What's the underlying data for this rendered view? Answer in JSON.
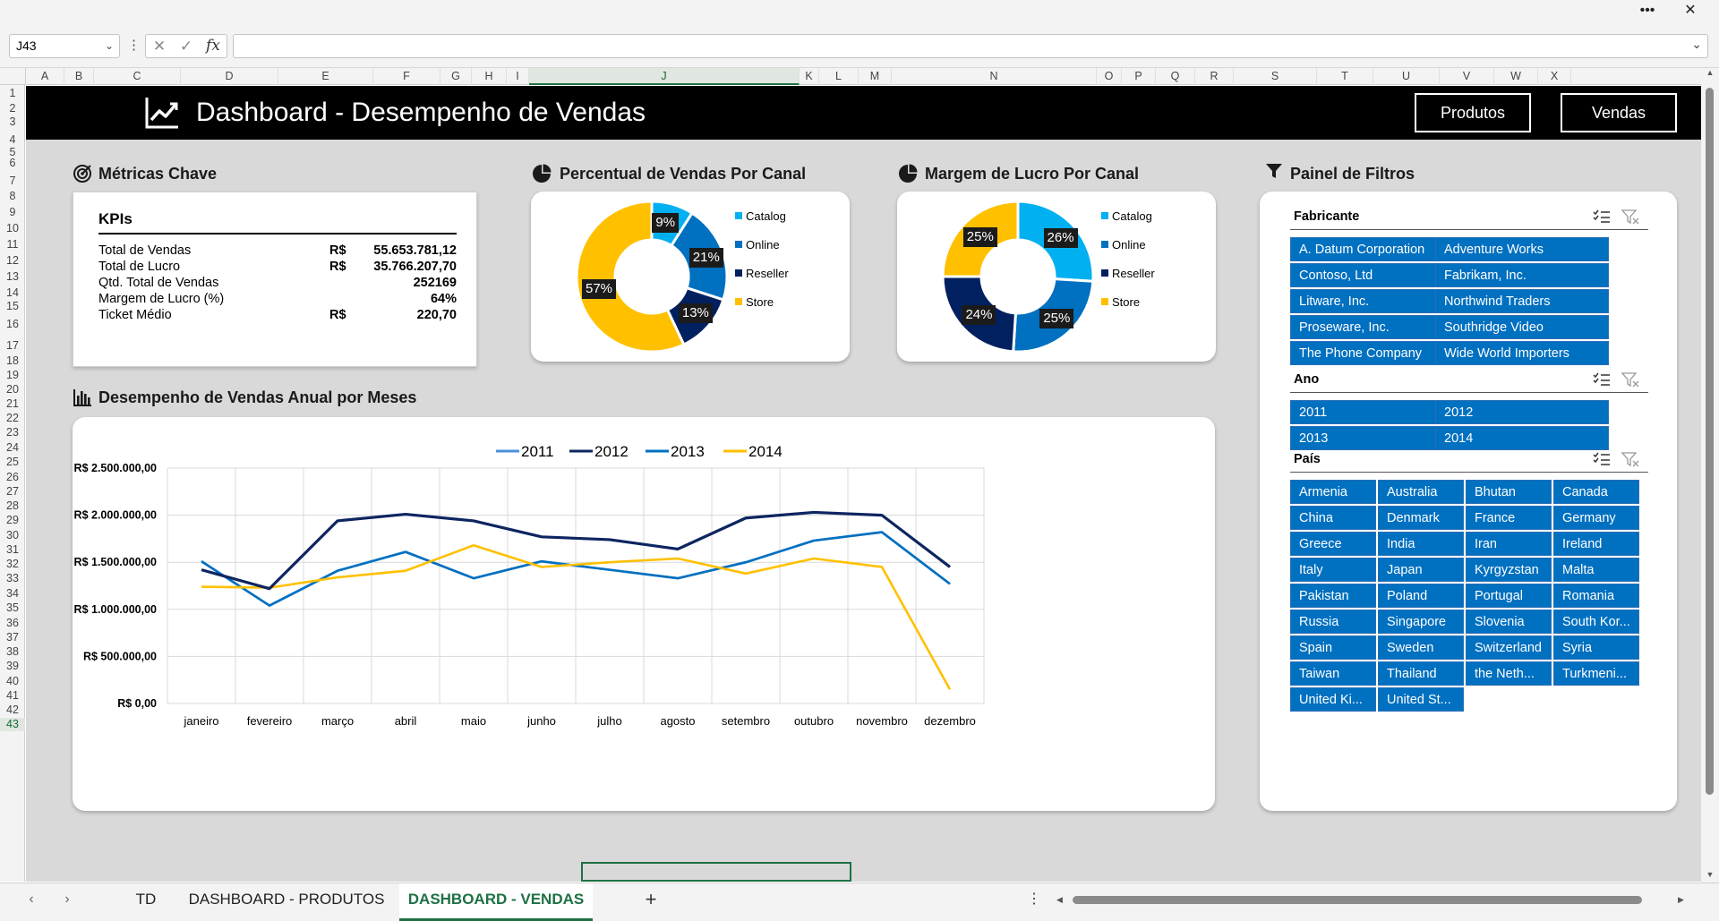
{
  "window": {
    "more_label": "•••",
    "close_label": "✕"
  },
  "formula_bar": {
    "cell_ref": "J43",
    "fx_label": "fx",
    "cancel_label": "✕",
    "confirm_label": "✓",
    "formula": ""
  },
  "columns": [
    "A",
    "B",
    "C",
    "D",
    "E",
    "F",
    "G",
    "H",
    "I",
    "J",
    "K",
    "L",
    "M",
    "N",
    "O",
    "P",
    "Q",
    "R",
    "S",
    "T",
    "U",
    "V",
    "W",
    "X"
  ],
  "selected_column": "J",
  "rows": [
    "1",
    "2",
    "3",
    "4",
    "5",
    "6",
    "7",
    "8",
    "9",
    "10",
    "11",
    "12",
    "13",
    "14",
    "15",
    "16",
    "17",
    "18",
    "19",
    "20",
    "21",
    "22",
    "23",
    "24",
    "25",
    "26",
    "27",
    "28",
    "29",
    "30",
    "31",
    "32",
    "33",
    "34",
    "35",
    "36",
    "37",
    "38",
    "39",
    "40",
    "41",
    "42",
    "43"
  ],
  "selected_row": "43",
  "dashboard": {
    "title": "Dashboard - Desempenho de Vendas",
    "nav_buttons": [
      "Produtos",
      "Vendas"
    ],
    "kpi_section": {
      "title": "Métricas Chave",
      "card_title": "KPIs",
      "rows": [
        {
          "label": "Total de Vendas",
          "currency": "R$",
          "value": "55.653.781,12"
        },
        {
          "label": "Total de Lucro",
          "currency": "R$",
          "value": "35.766.207,70"
        },
        {
          "label": "Qtd. Total de Vendas",
          "currency": "",
          "value": "252169"
        },
        {
          "label": "Margem de Lucro (%)",
          "currency": "",
          "value": "64%"
        },
        {
          "label": "Ticket Médio",
          "currency": "R$",
          "value": "220,70"
        }
      ]
    },
    "sales_channel": {
      "title": "Percentual de Vendas Por Canal",
      "legend": [
        "Catalog",
        "Online",
        "Reseller",
        "Store"
      ],
      "labels": [
        "9%",
        "21%",
        "13%",
        "57%"
      ]
    },
    "margin_channel": {
      "title": "Margem de Lucro Por Canal",
      "legend": [
        "Catalog",
        "Online",
        "Reseller",
        "Store"
      ],
      "labels": [
        "26%",
        "25%",
        "24%",
        "25%"
      ]
    },
    "line_section": {
      "title": "Desempenho de Vendas Anual por Meses"
    },
    "filters": {
      "title": "Painel de Filtros",
      "fabricante": {
        "title": "Fabricante",
        "items": [
          "A. Datum Corporation",
          "Adventure Works",
          "Contoso, Ltd",
          "Fabrikam, Inc.",
          "Litware, Inc.",
          "Northwind Traders",
          "Proseware, Inc.",
          "Southridge Video",
          "The Phone Company",
          "Wide World Importers"
        ]
      },
      "ano": {
        "title": "Ano",
        "items": [
          "2011",
          "2012",
          "2013",
          "2014"
        ]
      },
      "pais": {
        "title": "País",
        "items": [
          "Armenia",
          "Australia",
          "Bhutan",
          "Canada",
          "China",
          "Denmark",
          "France",
          "Germany",
          "Greece",
          "India",
          "Iran",
          "Ireland",
          "Italy",
          "Japan",
          "Kyrgyzstan",
          "Malta",
          "Pakistan",
          "Poland",
          "Portugal",
          "Romania",
          "Russia",
          "Singapore",
          "Slovenia",
          "South Kor...",
          "Spain",
          "Sweden",
          "Switzerland",
          "Syria",
          "Taiwan",
          "Thailand",
          "the Neth...",
          "Turkmeni...",
          "United Ki...",
          "United St..."
        ]
      }
    }
  },
  "tabs": {
    "items": [
      "TD",
      "DASHBOARD - PRODUTOS",
      "DASHBOARD - VENDAS"
    ],
    "active": "DASHBOARD - VENDAS",
    "add_label": "+",
    "prev_label": "‹",
    "next_label": "›",
    "more_label": "⋮"
  },
  "colors": {
    "catalog": "#00b0f0",
    "online": "#0070c0",
    "reseller": "#002060",
    "store": "#ffc000",
    "y2011": "#4a90d9",
    "y2012": "#0d2560",
    "y2013": "#0070c0",
    "y2014": "#ffc000",
    "slicer": "#0070c0"
  },
  "chart_data": [
    {
      "type": "pie",
      "title": "Percentual de Vendas Por Canal",
      "categories": [
        "Catalog",
        "Online",
        "Reseller",
        "Store"
      ],
      "values": [
        9,
        21,
        13,
        57
      ],
      "legend": "right"
    },
    {
      "type": "pie",
      "title": "Margem de Lucro Por Canal",
      "categories": [
        "Catalog",
        "Online",
        "Reseller",
        "Store"
      ],
      "values": [
        26,
        25,
        24,
        25
      ],
      "legend": "right"
    },
    {
      "type": "line",
      "title": "Desempenho de Vendas Anual por Meses",
      "categories": [
        "janeiro",
        "fevereiro",
        "março",
        "abril",
        "maio",
        "junho",
        "julho",
        "agosto",
        "setembro",
        "outubro",
        "novembro",
        "dezembro"
      ],
      "series": [
        {
          "name": "2011",
          "values": [
            1510000,
            1040000,
            1410000,
            1610000,
            1330000,
            1510000,
            1420000,
            1330000,
            1500000,
            1730000,
            1820000,
            1270000
          ]
        },
        {
          "name": "2012",
          "values": [
            1420000,
            1220000,
            1940000,
            2010000,
            1940000,
            1770000,
            1740000,
            1640000,
            1970000,
            2030000,
            2000000,
            1450000
          ]
        },
        {
          "name": "2013",
          "values": [
            1510000,
            1040000,
            1410000,
            1610000,
            1330000,
            1510000,
            1420000,
            1330000,
            1500000,
            1730000,
            1820000,
            1270000
          ]
        },
        {
          "name": "2014",
          "values": [
            1240000,
            1230000,
            1340000,
            1410000,
            1680000,
            1450000,
            1500000,
            1540000,
            1380000,
            1540000,
            1450000,
            150000
          ]
        }
      ],
      "yticks": [
        "R$ 0,00",
        "R$ 500.000,00",
        "R$ 1.000.000,00",
        "R$ 1.500.000,00",
        "R$ 2.000.000,00",
        "R$ 2.500.000,00"
      ],
      "ylim": [
        0,
        2500000
      ],
      "grid": true,
      "legend": "top"
    }
  ]
}
